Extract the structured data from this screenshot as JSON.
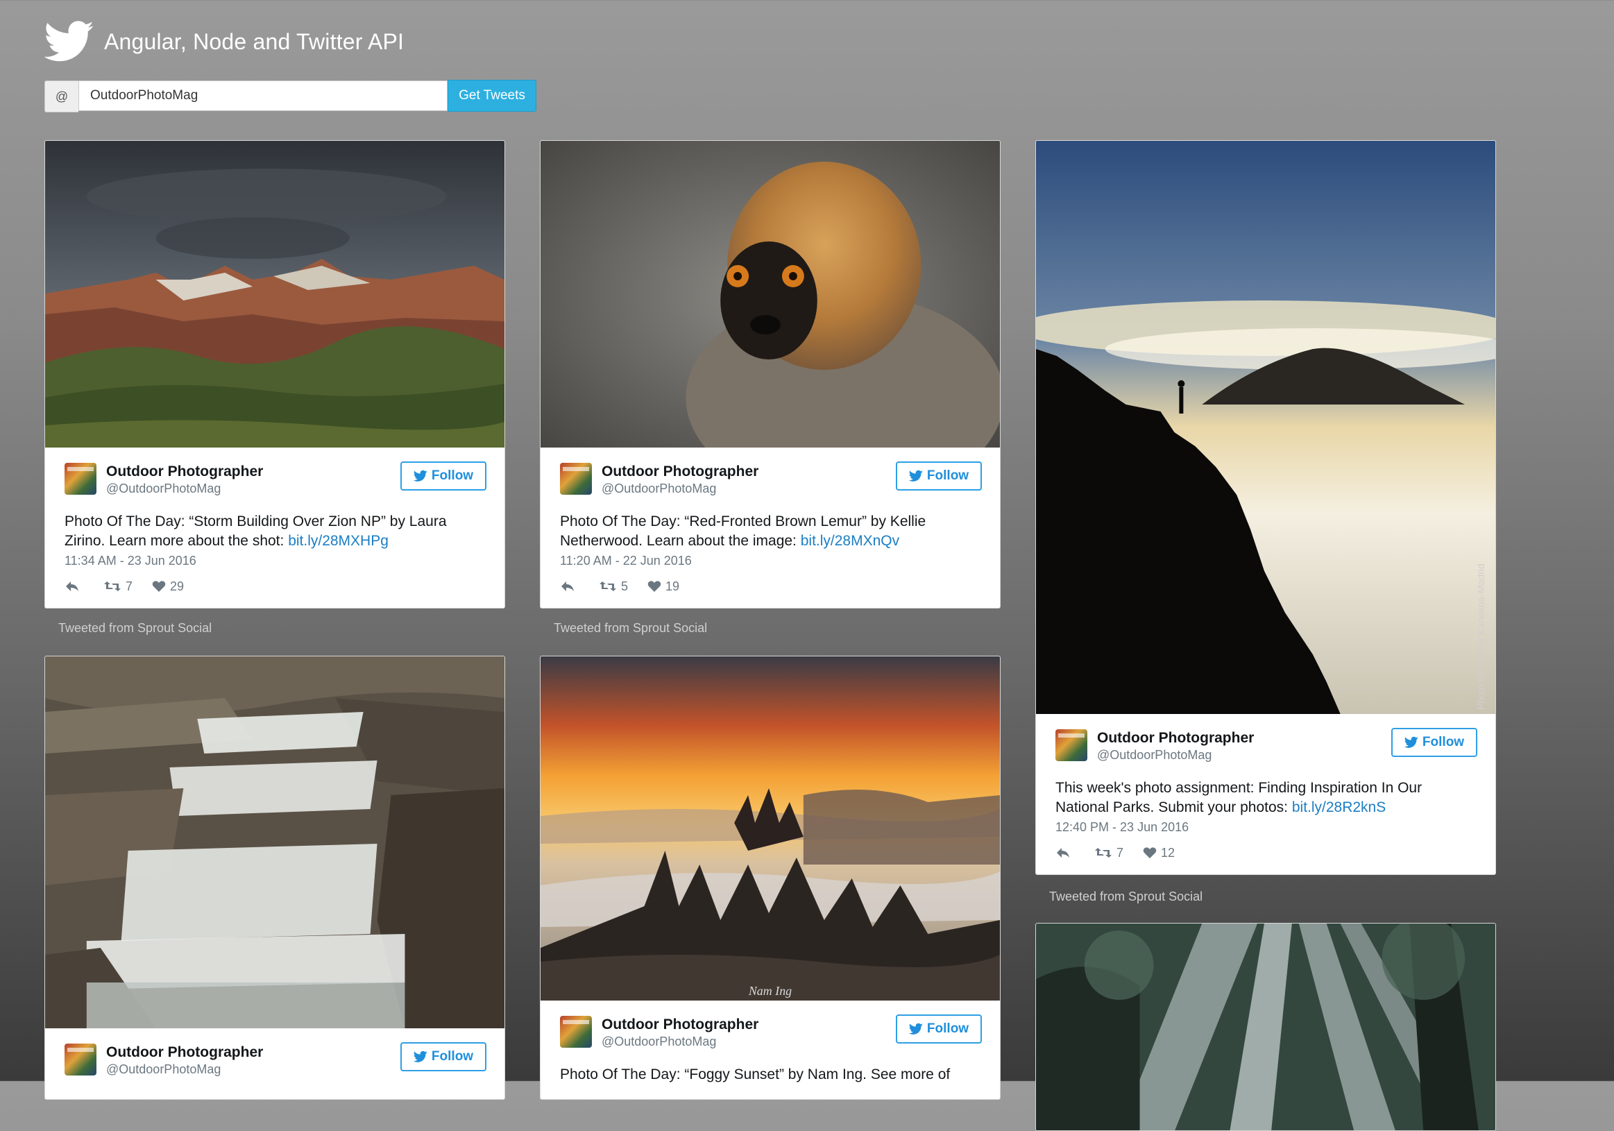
{
  "app": {
    "title": "Angular, Node and Twitter API"
  },
  "search": {
    "prefix": "@",
    "value": "OutdoorPhotoMag",
    "button_label": "Get Tweets"
  },
  "tweets": [
    {
      "name": "Outdoor Photographer",
      "handle": "@OutdoorPhotoMag",
      "follow_label": "Follow",
      "text": "Photo Of The Day: “Storm Building Over Zion NP” by Laura Zirino. Learn more about the shot: ",
      "link": "bit.ly/28MXHPg",
      "time": "11:34 AM - 23 Jun 2016",
      "retweets": "7",
      "likes": "29",
      "source": "Tweeted from Sprout Social"
    },
    {
      "name": "Outdoor Photographer",
      "handle": "@OutdoorPhotoMag",
      "follow_label": "Follow",
      "text": "Photo Of The Day: “Red-Fronted Brown Lemur” by Kellie Netherwood. Learn about the image: ",
      "link": "bit.ly/28MXnQv",
      "time": "11:20 AM - 22 Jun 2016",
      "retweets": "5",
      "likes": "19",
      "source": "Tweeted from Sprout Social"
    },
    {
      "name": "Outdoor Photographer",
      "handle": "@OutdoorPhotoMag",
      "follow_label": "Follow",
      "text": "This week's photo assignment: Finding Inspiration In Our National Parks. Submit your photos: ",
      "link": "bit.ly/28R2knS",
      "time": "12:40 PM - 23 Jun 2016",
      "retweets": "7",
      "likes": "12",
      "source": "Tweeted from Sprout Social"
    },
    {
      "name": "Outdoor Photographer",
      "handle": "@OutdoorPhotoMag",
      "follow_label": "Follow"
    },
    {
      "name": "Outdoor Photographer",
      "handle": "@OutdoorPhotoMag",
      "follow_label": "Follow",
      "text": "Photo Of The Day: “Foggy Sunset” by Nam Ing. See more of"
    }
  ],
  "photo_credits": {
    "silhouette": "Photo By Audrey Kanekoa-Madrid",
    "sunset": "Nam Ing"
  },
  "icons": {
    "logo": "twitter-bird-icon",
    "reply": "reply-icon",
    "retweet": "retweet-icon",
    "like": "heart-icon"
  },
  "colors": {
    "accent": "#2db0e0",
    "follow": "#1f8fdc",
    "link": "#1b7ec4"
  }
}
